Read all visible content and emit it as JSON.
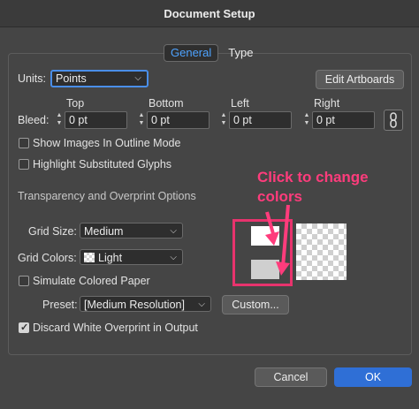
{
  "window": {
    "title": "Document Setup"
  },
  "tabs": [
    {
      "label": "General",
      "active": true
    },
    {
      "label": "Type",
      "active": false
    }
  ],
  "units": {
    "label": "Units:",
    "value": "Points"
  },
  "edit_artboards": "Edit Artboards",
  "bleed": {
    "label": "Bleed:",
    "fields": [
      {
        "label": "Top",
        "value": "0 pt"
      },
      {
        "label": "Bottom",
        "value": "0 pt"
      },
      {
        "label": "Left",
        "value": "0 pt"
      },
      {
        "label": "Right",
        "value": "0 pt"
      }
    ]
  },
  "options": {
    "show_images": {
      "label": "Show Images In Outline Mode",
      "checked": false
    },
    "highlight_glyphs": {
      "label": "Highlight Substituted Glyphs",
      "checked": false
    }
  },
  "transparency": {
    "section_label": "Transparency and Overprint Options",
    "grid_size": {
      "label": "Grid Size:",
      "value": "Medium"
    },
    "grid_colors": {
      "label": "Grid Colors:",
      "value": "Light"
    },
    "simulate_paper": {
      "label": "Simulate Colored Paper",
      "checked": false
    },
    "preset": {
      "label": "Preset:",
      "value": "[Medium Resolution]"
    },
    "custom_button": "Custom...",
    "discard_white": {
      "label": "Discard White Overprint in Output",
      "checked": true
    }
  },
  "annotation": {
    "text": "Click to change colors",
    "color": "#ff3c7c"
  },
  "footer": {
    "cancel": "Cancel",
    "ok": "OK"
  },
  "colors": {
    "accent": "#2f6fd6",
    "tab_active_text": "#4ea3ff",
    "annotation": "#e8336d"
  }
}
